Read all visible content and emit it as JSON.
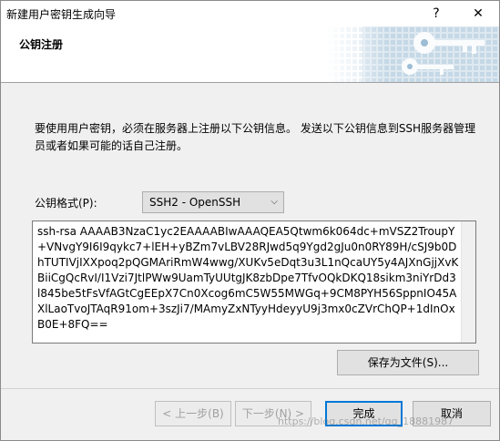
{
  "window": {
    "title": "新建用户密钥生成向导",
    "help_glyph": "?",
    "close_glyph": "✕"
  },
  "header": {
    "title": "公钥注册"
  },
  "description": "要使用用户密钥，必须在服务器上注册以下公钥信息。 发送以下公钥信息到SSH服务器管理员或者如果可能的话自己注册。",
  "format": {
    "label": "公钥格式(P):",
    "selected": "SSH2 - OpenSSH"
  },
  "public_key": "ssh-rsa AAAAB3NzaC1yc2EAAAABIwAAAQEA5Qtwm6k064dc+mVSZ2TroupY+VNvgY9I6I9qykc7+lEH+yBZm7vLBV28RJwd5q9Ygd2gJu0n0RY89H/cSJ9b0DhTUTIVjIXXpoq2pQGMAriRmW4wwg/XUKv5eDqt3u3L1nQcaUY5y4AJXnGjjXvKBiiCgQcRvI/I1Vzi7JtlPWw9UamTyUUtgJK8zbDpe7TfvOQkDKQ18sikm3niYrDd3l845be5tFsVfAGtCgEEpX7Cn0Xcog6mC5W55MWGq+9CM8PYH56SppnIO45AXlLaoTvoJTAqR91om+3szJi7/MAmyZxNTyyHdeyyU9j3mx0cZVrChQP+1dInOxB0E+8FQ==",
  "buttons": {
    "save": "保存为文件(S)...",
    "back": "< 上一步(B)",
    "next": "下一步(N) >",
    "finish": "完成",
    "cancel": "取消"
  },
  "watermark": "https://blog.csdn.net/qq_18881987",
  "colors": {
    "focus_border": "#0078d7",
    "banner_blue": "#7aa7c7"
  }
}
